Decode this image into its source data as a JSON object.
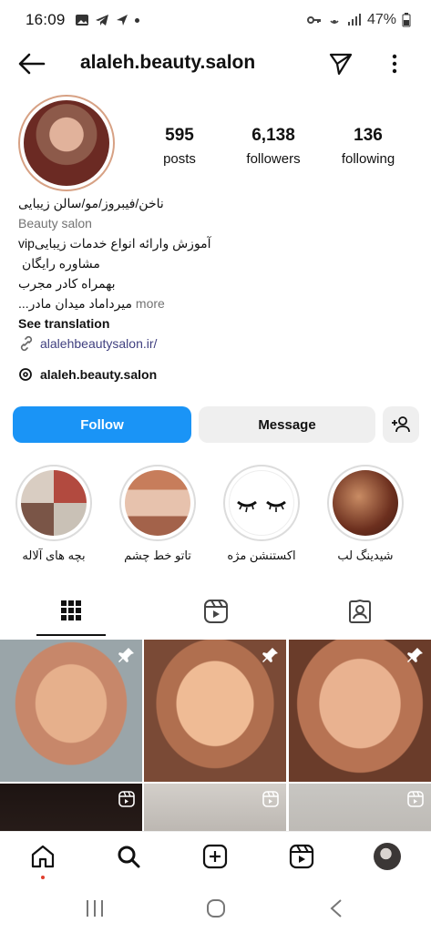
{
  "status": {
    "time": "16:09",
    "battery": "47%"
  },
  "profile": {
    "username": "alaleh.beauty.salon"
  },
  "stats": [
    {
      "value": "595",
      "label": "posts"
    },
    {
      "value": "6,138",
      "label": "followers"
    },
    {
      "value": "136",
      "label": "following"
    }
  ],
  "bio": {
    "line1": "ناخن/فیبروز/مو/سالن زیبایی",
    "category": "Beauty salon",
    "line2": "vipآموزش وارائه انواع خدمات زیبایی",
    "line3": "مشاوره رایگان",
    "line4": "بهمراه کادر مجرب",
    "line5": "میرداماد میدان مادر...",
    "more": "more",
    "see_translation": "See translation",
    "link": "alalehbeautysalon.ir/",
    "threads": "alaleh.beauty.salon"
  },
  "actions": {
    "follow": "Follow",
    "message": "Message"
  },
  "highlights": [
    {
      "label": "شیدینگ لب"
    },
    {
      "label": "اکستنشن مژه"
    },
    {
      "label": "تاتو خط چشم"
    },
    {
      "label": "بچه های آلاله"
    }
  ],
  "colors": {
    "accent": "#1a94f6",
    "text": "#111111",
    "muted": "#737373",
    "link": "#3f3f7f"
  }
}
